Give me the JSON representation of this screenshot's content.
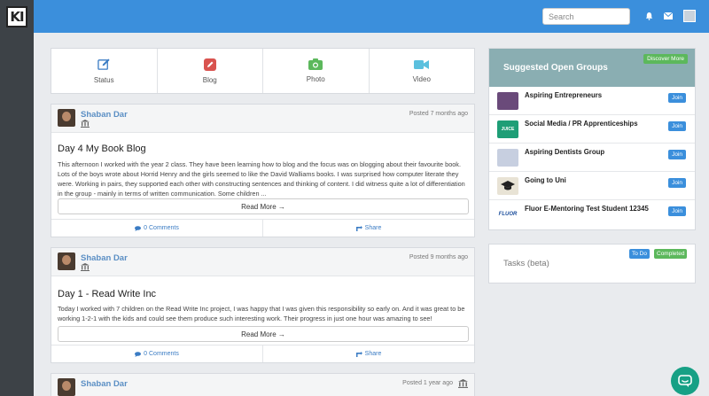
{
  "app": {
    "logo_text": "KI"
  },
  "header": {
    "search_placeholder": "Search",
    "icons": [
      "bell-icon",
      "mail-icon",
      "profile-icon"
    ]
  },
  "post_types": [
    {
      "label": "Status",
      "icon": "edit-icon",
      "color": "#3b7cc4"
    },
    {
      "label": "Blog",
      "icon": "pencil-icon",
      "color": "#d9534f"
    },
    {
      "label": "Photo",
      "icon": "camera-icon",
      "color": "#5cb85c"
    },
    {
      "label": "Video",
      "icon": "video-icon",
      "color": "#5bc0de"
    }
  ],
  "posts": [
    {
      "author": "Shaban Dar",
      "time": "Posted 7 months ago",
      "title": "Day 4 My Book Blog",
      "body": "This afternoon I worked with the year 2 class. They have been learning how to blog and the focus was on blogging about their favourite book. Lots of the boys wrote about Horrid Henry and the girls seemed to like the David Walliams books. I was surprised how computer literate they were. Working in pairs, they supported each other with constructing sentences and thinking of content. I did witness quite a lot of differentiation in the group - mainly in terms of written communication. Some children ...",
      "read_more": "Read More →",
      "comments": "0 Comments",
      "share": "Share"
    },
    {
      "author": "Shaban Dar",
      "time": "Posted 9 months ago",
      "title": "Day 1 - Read Write Inc",
      "body": "Today I worked with 7 children on the Read Write Inc project, I was happy that I was given this responsibility so early on. And it was great to be working 1-2-1 with the kids and could see them produce such interesting work. Their progress in just one hour was amazing to see!",
      "read_more": "Read More →",
      "comments": "0 Comments",
      "share": "Share"
    },
    {
      "author": "Shaban Dar",
      "time": "Posted 1 year ago"
    }
  ],
  "groups": {
    "title": "Suggested Open Groups",
    "discover_label": "Discover More",
    "join_label": "Join",
    "items": [
      {
        "name": "Aspiring Entrepreneurs",
        "thumb_color": "#6a4a7a"
      },
      {
        "name": "Social Media / PR Apprenticeships",
        "thumb_color": "#1e9e76",
        "thumb_text": "JUICE"
      },
      {
        "name": "Aspiring Dentists Group",
        "thumb_color": "#c7cfe0"
      },
      {
        "name": "Going to Uni",
        "thumb_color": "#e8e3d5"
      },
      {
        "name": "Fluor E-Mentoring Test Student 12345",
        "thumb_color": "#ffffff",
        "thumb_text": "FLUOR"
      }
    ]
  },
  "tasks": {
    "title": "Tasks (beta)",
    "todo_label": "To Do",
    "completed_label": "Completed"
  }
}
